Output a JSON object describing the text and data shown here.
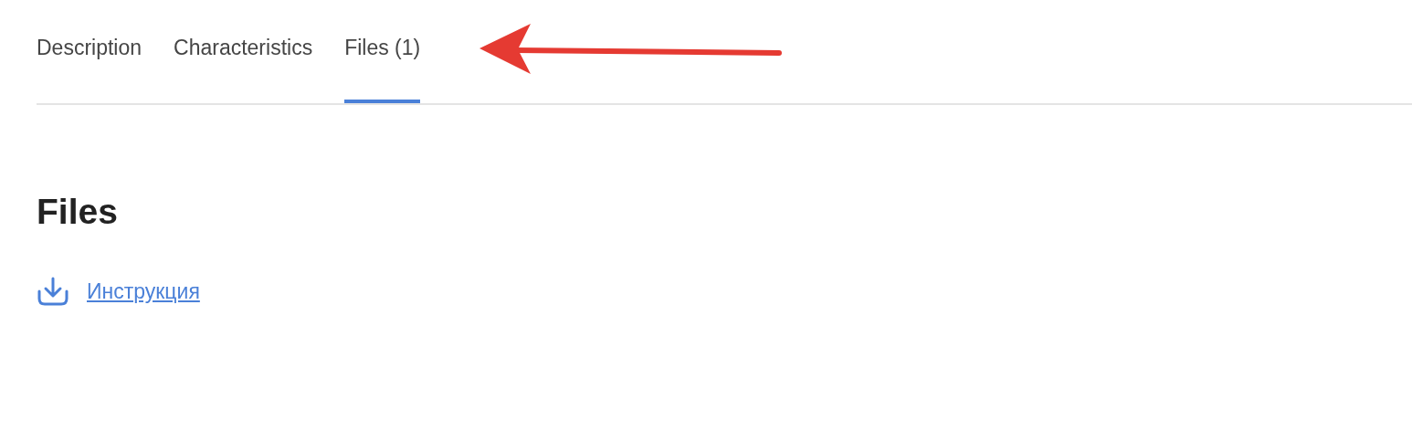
{
  "tabs": [
    {
      "label": "Description",
      "selected": false
    },
    {
      "label": "Characteristics",
      "selected": false
    },
    {
      "label": "Files (1)",
      "selected": true
    }
  ],
  "section": {
    "title": "Files",
    "files": [
      {
        "label": "Инструкция"
      }
    ]
  }
}
